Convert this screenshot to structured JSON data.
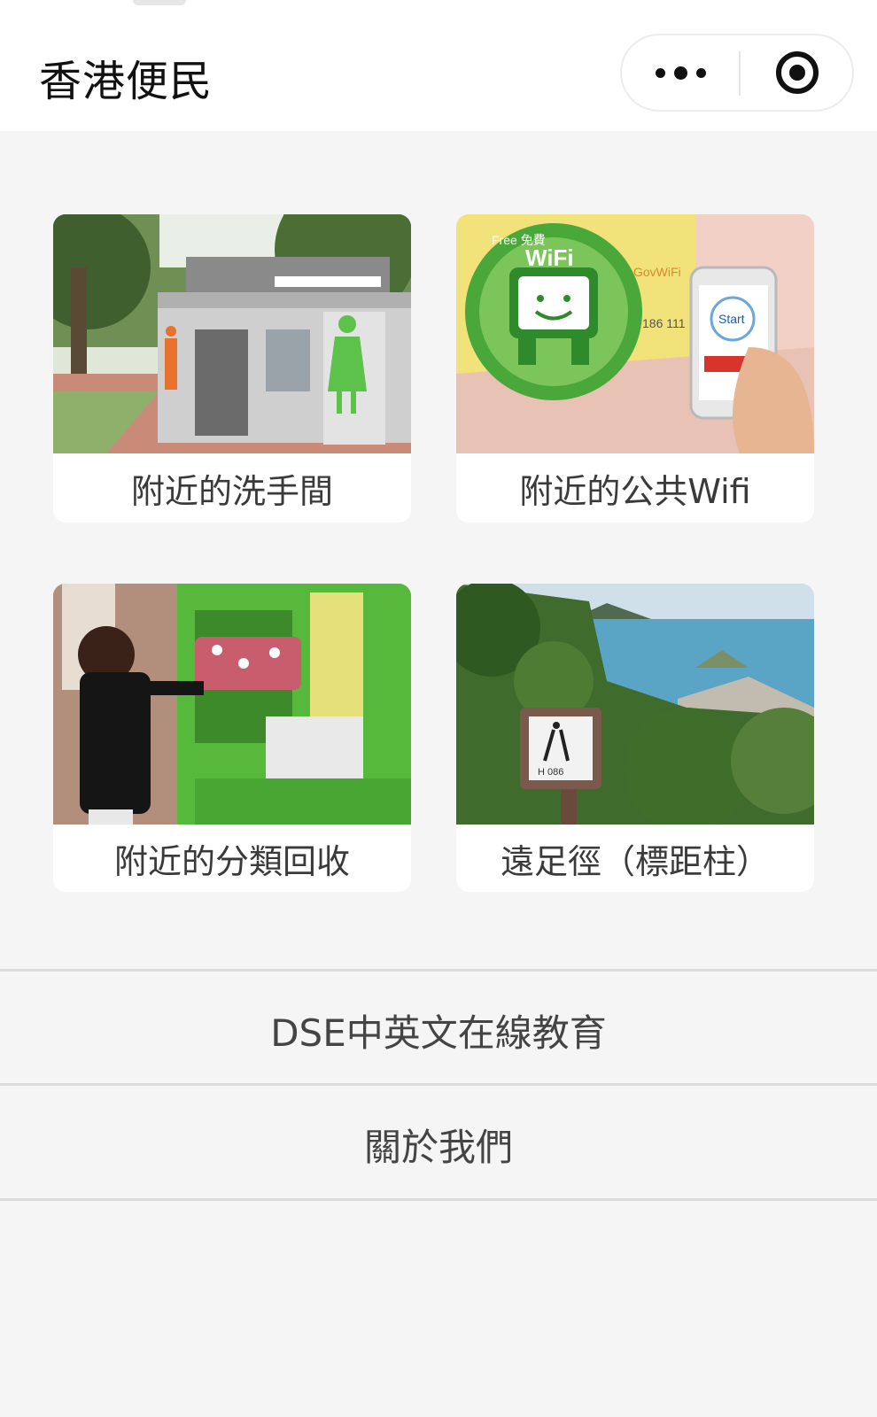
{
  "navbar": {
    "title": "香港便民"
  },
  "icons": {
    "more": "more-dots-icon",
    "close": "target-circle-icon"
  },
  "cards": [
    {
      "label": "附近的洗手間"
    },
    {
      "label": "附近的公共Wifi"
    },
    {
      "label": "附近的分類回收"
    },
    {
      "label": "遠足徑（標距柱）"
    }
  ],
  "menu": {
    "items": [
      {
        "label": "DSE中英文在線教育"
      },
      {
        "label": "關於我們"
      }
    ]
  },
  "image_text": {
    "wifi_badge_free": "Free 免費",
    "wifi_badge": "WiFi",
    "gov_wifi": "GovWiFi",
    "hotline": "186 111",
    "phone_start": "Start",
    "marker_code": "H 086"
  },
  "colors": {
    "page_bg": "#f5f5f5",
    "card_bg": "#ffffff",
    "text": "#3a3a3a",
    "divider": "#dcdcdc"
  }
}
